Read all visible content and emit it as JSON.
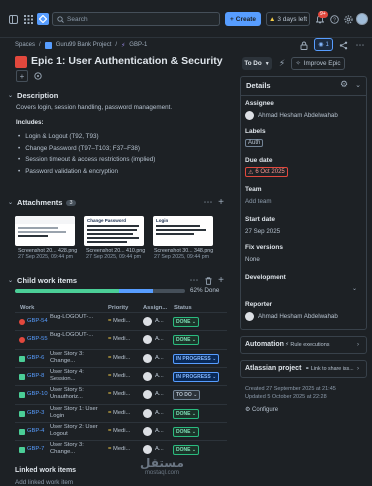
{
  "topbar": {
    "search_placeholder": "Search",
    "create_label": "Create",
    "days_left_label": "3 days left",
    "notifications_count": "9+"
  },
  "breadcrumb": [
    "Spaces",
    "Guru99 Bank Project",
    "GBP-1"
  ],
  "issue": {
    "title": "Epic 1: User Authentication & Security",
    "status": "To Do",
    "improve_label": "Improve Epic",
    "watch_count": "1"
  },
  "description": {
    "heading": "Description",
    "intro": "Covers login, session handling, password management.",
    "includes_label": "Includes:",
    "items": [
      "Login & Logout (T92, T93)",
      "Change Password (T97–T103; F37–F38)",
      "Session timeout & access restrictions (implied)",
      "Password validation & encryption"
    ]
  },
  "attachments": {
    "heading": "Attachments",
    "count": "3",
    "files": [
      {
        "name": "Screenshot 20... 428.png",
        "date": "27 Sep 2025, 09:44 pm"
      },
      {
        "name": "Screenshot 20... 410.png",
        "date": "27 Sep 2025, 09:44 pm"
      },
      {
        "name": "Screenshot 30... 348.png",
        "date": "27 Sep 2025, 09:44 pm"
      }
    ],
    "thumb2_title": "Change Password",
    "thumb3_title": "Login"
  },
  "child_items": {
    "heading": "Child work items",
    "progress_label": "62% Done",
    "done_fraction": 0.62,
    "columns": [
      "Work",
      "Priority",
      "Assign...",
      "Status"
    ],
    "rows": [
      {
        "key": "GBP-54",
        "summary": "Bug-LOGOUT-...",
        "priority": "Medi...",
        "assignee": "A...",
        "status": "DONE",
        "type": "bug"
      },
      {
        "key": "GBP-55",
        "summary": "Bug-LOGOUT-...",
        "priority": "Medi...",
        "assignee": "A...",
        "status": "DONE",
        "type": "bug"
      },
      {
        "key": "GBP-6",
        "summary": "User Story 3: Change...",
        "priority": "Medi...",
        "assignee": "A...",
        "status": "IN PROGRESS",
        "type": "story"
      },
      {
        "key": "GBP-8",
        "summary": "User Story 4: Session...",
        "priority": "Medi...",
        "assignee": "A...",
        "status": "IN PROGRESS",
        "type": "story"
      },
      {
        "key": "GBP-10",
        "summary": "User Story 5: Unauthoriz...",
        "priority": "Medi...",
        "assignee": "A...",
        "status": "TO DO",
        "type": "story"
      },
      {
        "key": "GBP-3",
        "summary": "User Story 1: User Login",
        "priority": "Medi...",
        "assignee": "A...",
        "status": "DONE",
        "type": "story"
      },
      {
        "key": "GBP-4",
        "summary": "User Story 2: User Logout",
        "priority": "Medi...",
        "assignee": "A...",
        "status": "DONE",
        "type": "story"
      },
      {
        "key": "GBP-7",
        "summary": "User Story 3: Change...",
        "priority": "Medi...",
        "assignee": "A...",
        "status": "DONE",
        "type": "story"
      }
    ]
  },
  "linked": {
    "heading": "Linked work items",
    "add_label": "Add linked work item"
  },
  "details": {
    "heading": "Details",
    "assignee_label": "Assignee",
    "assignee": "Ahmad Hesham Abdelwahab",
    "labels_label": "Labels",
    "label_value": "Auth",
    "due_label": "Due date",
    "due_value": "6 Oct 2025",
    "team_label": "Team",
    "team_value": "Add team",
    "start_label": "Start date",
    "start_value": "27 Sep 2025",
    "fix_label": "Fix versions",
    "fix_value": "None",
    "dev_label": "Development",
    "reporter_label": "Reporter",
    "reporter": "Ahmad Hesham Abdelwahab"
  },
  "automation": {
    "heading": "Automation",
    "value": "Rule executions"
  },
  "atlassian": {
    "heading": "Atlassian project",
    "value": "Link to share iss..."
  },
  "meta": {
    "created": "Created 27 September 2025 at 21:45",
    "updated": "Updated 5 October 2025 at 22:28",
    "configure": "Configure"
  },
  "watermark": {
    "arabic": "مستقل",
    "latin": "mostaql.com"
  },
  "colors": {
    "accent": "#579dff",
    "done": "#4bce97",
    "epic": "#e2483d",
    "bg": "#1d2125"
  }
}
